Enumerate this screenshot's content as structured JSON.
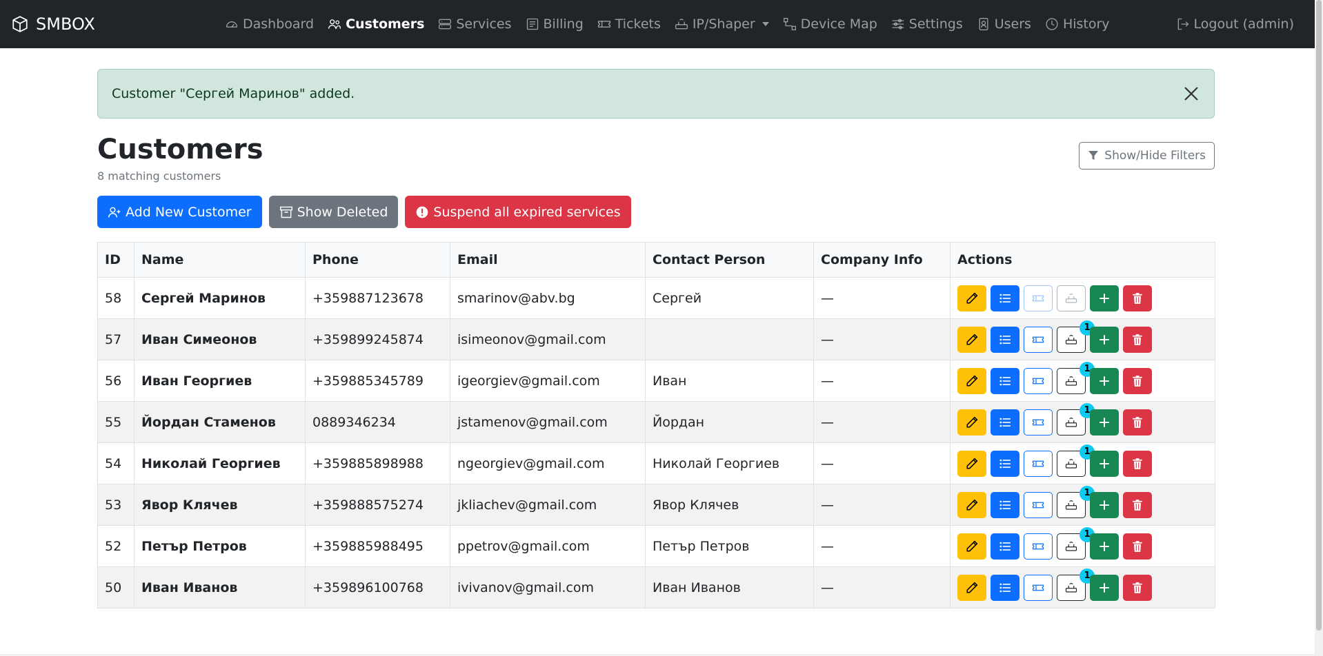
{
  "brand": {
    "name": "SMBOX",
    "icon": "box-icon"
  },
  "nav": [
    {
      "label": "Dashboard",
      "icon": "gauge-icon",
      "active": false
    },
    {
      "label": "Customers",
      "icon": "people-icon",
      "active": true
    },
    {
      "label": "Services",
      "icon": "server-icon",
      "active": false
    },
    {
      "label": "Billing",
      "icon": "receipt-icon",
      "active": false
    },
    {
      "label": "Tickets",
      "icon": "ticket-icon",
      "active": false
    },
    {
      "label": "IP/Shaper",
      "icon": "router-icon",
      "active": false,
      "dropdown": true
    },
    {
      "label": "Device Map",
      "icon": "diagram-icon",
      "active": false
    },
    {
      "label": "Settings",
      "icon": "sliders-icon",
      "active": false
    },
    {
      "label": "Users",
      "icon": "person-badge-icon",
      "active": false
    },
    {
      "label": "History",
      "icon": "clock-icon",
      "active": false
    }
  ],
  "logout_label": "Logout (admin)",
  "alert": {
    "text": "Customer \"Сергей Маринов\" added."
  },
  "page": {
    "title": "Customers",
    "subtitle": "8 matching customers",
    "filters_label": "Show/Hide Filters"
  },
  "buttons": {
    "add": "Add New Customer",
    "deleted": "Show Deleted",
    "suspend": "Suspend all expired services"
  },
  "table": {
    "headers": [
      "ID",
      "Name",
      "Phone",
      "Email",
      "Contact Person",
      "Company Info",
      "Actions"
    ],
    "rows": [
      {
        "id": "58",
        "name": "Сергей Маринов",
        "phone": "+359887123678",
        "email": "smarinov@abv.bg",
        "contact": "Сергей",
        "company": "—",
        "ip_count": ""
      },
      {
        "id": "57",
        "name": "Иван Симеонов",
        "phone": "+359899245874",
        "email": "isimeonov@gmail.com",
        "contact": "",
        "company": "—",
        "ip_count": "1"
      },
      {
        "id": "56",
        "name": "Иван Георгиев",
        "phone": "+359885345789",
        "email": "igeorgiev@gmail.com",
        "contact": "Иван",
        "company": "—",
        "ip_count": "1"
      },
      {
        "id": "55",
        "name": "Йордан Стаменов",
        "phone": "0889346234",
        "email": "jstamenov@gmail.com",
        "contact": "Йордан",
        "company": "—",
        "ip_count": "1"
      },
      {
        "id": "54",
        "name": "Николай Георгиев",
        "phone": "+359885898988",
        "email": "ngeorgiev@gmail.com",
        "contact": "Николай Георгиев",
        "company": "—",
        "ip_count": "1"
      },
      {
        "id": "53",
        "name": "Явор Клячев",
        "phone": "+359888575274",
        "email": "jkliachev@gmail.com",
        "contact": "Явор Клячев",
        "company": "—",
        "ip_count": "1"
      },
      {
        "id": "52",
        "name": "Петър Петров",
        "phone": "+359885988495",
        "email": "ppetrov@gmail.com",
        "contact": "Петър Петров",
        "company": "—",
        "ip_count": "1"
      },
      {
        "id": "50",
        "name": "Иван Иванов",
        "phone": "+359896100768",
        "email": "ivivanov@gmail.com",
        "contact": "Иван Иванов",
        "company": "—",
        "ip_count": "1"
      }
    ]
  },
  "colors": {
    "navbar": "#212529",
    "primary": "#0d6efd",
    "success": "#198754",
    "danger": "#dc3545",
    "warning": "#ffc107",
    "info": "#0dcaf0",
    "alert_bg": "#d1e7dd"
  }
}
